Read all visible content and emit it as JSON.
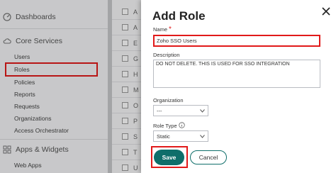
{
  "sidebar": {
    "dashboards": "Dashboards",
    "core_services": "Core Services",
    "items": [
      "Users",
      "Roles",
      "Policies",
      "Reports",
      "Requests",
      "Organizations",
      "Access Orchestrator"
    ],
    "apps_widgets": "Apps & Widgets",
    "web_apps": "Web Apps"
  },
  "background_list": [
    "A",
    "A",
    "E",
    "G",
    "H",
    "M",
    "O",
    "P",
    "S",
    "T",
    "U"
  ],
  "modal": {
    "title": "Add Role",
    "name_label": "Name",
    "name_value": "Zoho SSO Users",
    "description_label": "Description",
    "description_value": "DO NOT DELETE. THIS IS USED FOR SSO INTEGRATION",
    "organization_label": "Organization",
    "organization_value": "---",
    "role_type_label": "Role Type",
    "role_type_value": "Static",
    "save_label": "Save",
    "cancel_label": "Cancel"
  },
  "colors": {
    "accent": "#0f6e6a",
    "highlight": "#e11a1a"
  }
}
